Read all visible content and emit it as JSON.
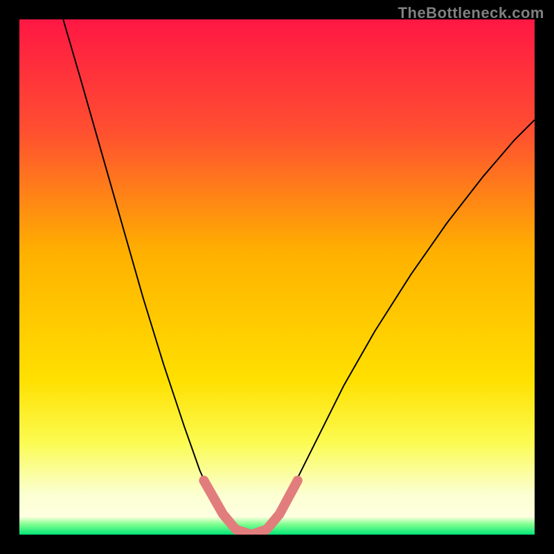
{
  "watermark": "TheBottleneck.com",
  "chart_data": {
    "type": "line",
    "title": "",
    "xlabel": "",
    "ylabel": "",
    "xlim": [
      0,
      1
    ],
    "ylim": [
      0,
      1
    ],
    "background": {
      "type": "vertical-gradient",
      "stops": [
        {
          "offset": 0.0,
          "color": "#ff1744"
        },
        {
          "offset": 0.22,
          "color": "#ff5030"
        },
        {
          "offset": 0.45,
          "color": "#ffb000"
        },
        {
          "offset": 0.7,
          "color": "#ffe000"
        },
        {
          "offset": 0.82,
          "color": "#fbfb50"
        },
        {
          "offset": 0.92,
          "color": "#fbffd0"
        },
        {
          "offset": 0.965,
          "color": "#ffffe0"
        },
        {
          "offset": 0.98,
          "color": "#80ff90"
        },
        {
          "offset": 1.0,
          "color": "#00e676"
        }
      ]
    },
    "series": [
      {
        "name": "bottleneck-curve",
        "stroke": "#000000",
        "stroke_width": 2,
        "points": [
          {
            "x": 0.085,
            "y": 1.0
          },
          {
            "x": 0.12,
            "y": 0.88
          },
          {
            "x": 0.16,
            "y": 0.74
          },
          {
            "x": 0.2,
            "y": 0.6
          },
          {
            "x": 0.24,
            "y": 0.46
          },
          {
            "x": 0.28,
            "y": 0.33
          },
          {
            "x": 0.32,
            "y": 0.21
          },
          {
            "x": 0.35,
            "y": 0.125
          },
          {
            "x": 0.37,
            "y": 0.08
          },
          {
            "x": 0.39,
            "y": 0.05
          },
          {
            "x": 0.41,
            "y": 0.02
          },
          {
            "x": 0.43,
            "y": 0.005
          },
          {
            "x": 0.45,
            "y": 0.0
          },
          {
            "x": 0.47,
            "y": 0.005
          },
          {
            "x": 0.49,
            "y": 0.02
          },
          {
            "x": 0.51,
            "y": 0.05
          },
          {
            "x": 0.54,
            "y": 0.11
          },
          {
            "x": 0.58,
            "y": 0.19
          },
          {
            "x": 0.63,
            "y": 0.29
          },
          {
            "x": 0.69,
            "y": 0.395
          },
          {
            "x": 0.76,
            "y": 0.505
          },
          {
            "x": 0.83,
            "y": 0.605
          },
          {
            "x": 0.9,
            "y": 0.695
          },
          {
            "x": 0.96,
            "y": 0.765
          },
          {
            "x": 1.0,
            "y": 0.805
          }
        ]
      },
      {
        "name": "highlight-band",
        "stroke": "#e27d7d",
        "stroke_width": 14,
        "linecap": "round",
        "points": [
          {
            "x": 0.358,
            "y": 0.105
          },
          {
            "x": 0.395,
            "y": 0.04
          },
          {
            "x": 0.42,
            "y": 0.01
          },
          {
            "x": 0.45,
            "y": 0.0
          },
          {
            "x": 0.48,
            "y": 0.01
          },
          {
            "x": 0.505,
            "y": 0.04
          },
          {
            "x": 0.54,
            "y": 0.105
          }
        ]
      }
    ]
  }
}
